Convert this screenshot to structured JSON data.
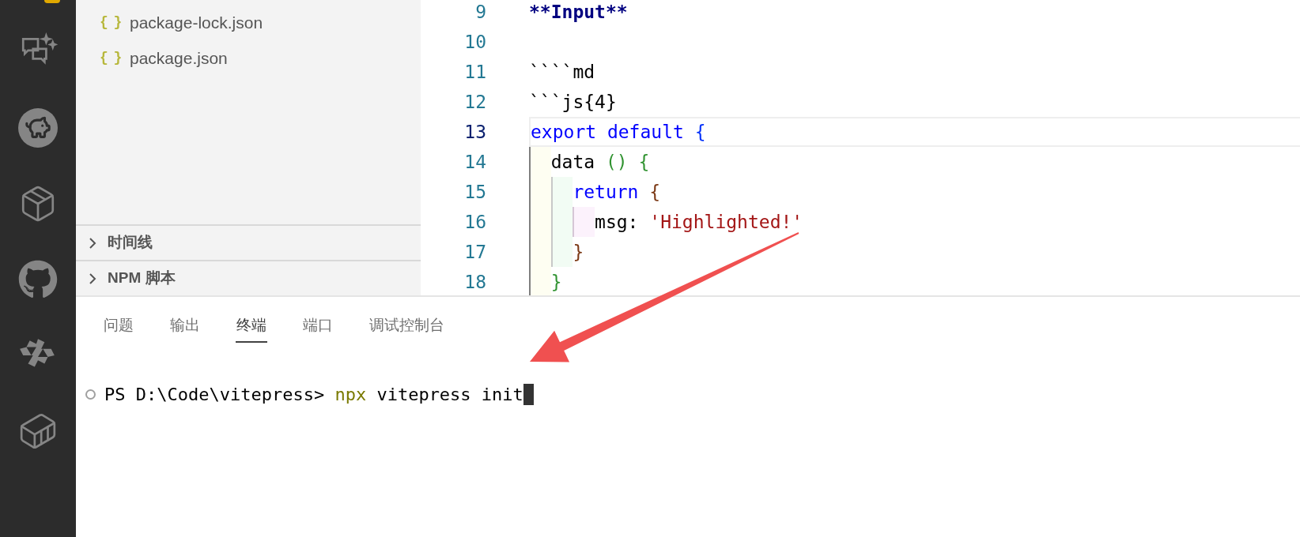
{
  "sidebar": {
    "files": [
      {
        "name": "package-lock.json",
        "icon": "{ }"
      },
      {
        "name": "package.json",
        "icon": "{ }"
      }
    ],
    "sections": [
      {
        "label": "时间线",
        "expanded": false
      },
      {
        "label": "NPM 脚本",
        "expanded": false
      }
    ]
  },
  "editor": {
    "lines": [
      {
        "number": "9",
        "current": false,
        "tokens": [
          {
            "text": "**Input**",
            "kind": "md-bold"
          }
        ]
      },
      {
        "number": "10",
        "current": false
      },
      {
        "number": "11",
        "current": false,
        "tokens": [
          {
            "text": "````md",
            "kind": "plain"
          }
        ]
      },
      {
        "number": "12",
        "current": false,
        "tokens": [
          {
            "text": "```js{4}",
            "kind": "plain"
          }
        ]
      },
      {
        "number": "13",
        "current": true,
        "tokens": [
          {
            "text": "export default ",
            "kind": "keyword"
          },
          {
            "text": "{",
            "kind": "bracket-1"
          }
        ]
      },
      {
        "number": "14",
        "current": false,
        "tokens": [
          {
            "text": "  data ",
            "kind": "plain"
          },
          {
            "text": "() {",
            "kind": "bracket-2"
          }
        ]
      },
      {
        "number": "15",
        "current": false,
        "tokens": [
          {
            "text": "    return ",
            "kind": "keyword"
          },
          {
            "text": "{",
            "kind": "bracket-3"
          }
        ]
      },
      {
        "number": "16",
        "current": false,
        "tokens": [
          {
            "text": "      msg: ",
            "kind": "plain"
          },
          {
            "text": "'Highlighted!'",
            "kind": "string"
          }
        ]
      },
      {
        "number": "17",
        "current": false,
        "tokens": [
          {
            "text": "    }",
            "kind": "bracket-3"
          }
        ]
      },
      {
        "number": "18",
        "current": false,
        "tokens": [
          {
            "text": "  }",
            "kind": "bracket-2"
          }
        ]
      }
    ]
  },
  "panel": {
    "tabs": [
      {
        "label": "问题",
        "selected": false
      },
      {
        "label": "输出",
        "selected": false
      },
      {
        "label": "终端",
        "selected": true
      },
      {
        "label": "端口",
        "selected": false
      },
      {
        "label": "调试控制台",
        "selected": false
      }
    ],
    "terminal": {
      "tokens": [
        {
          "text": "PS D:\\Code\\vitepress> ",
          "kind": "plain"
        },
        {
          "text": "npx",
          "kind": "command"
        },
        {
          "text": " vitepress init",
          "kind": "plain"
        }
      ]
    }
  }
}
